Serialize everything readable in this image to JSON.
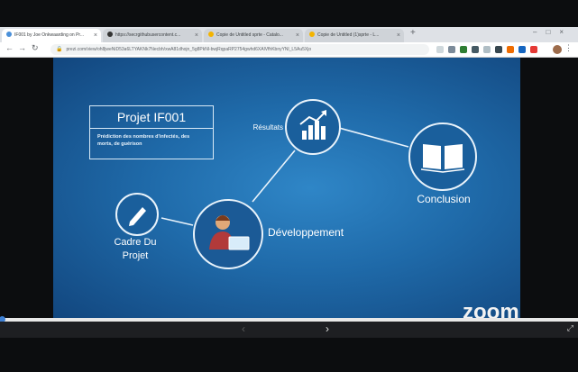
{
  "browser": {
    "tabs": [
      {
        "label": "IF001 by Joe Onkwaarding on Pr...",
        "active": true,
        "color": "#4a90d9"
      },
      {
        "label": "https://secrgithubusercontent.c...",
        "active": false,
        "color": "#333333"
      },
      {
        "label": "Copie de Untitled sprte - Catalo...",
        "active": false,
        "color": "#f4b400"
      },
      {
        "label": "Copie de Untitled (1)sprte - L...",
        "active": false,
        "color": "#f4b400"
      }
    ],
    "new_tab": "+",
    "url": "prezi.com/view/oh8jweNiD53a6LTYAKNk7Necbh/xwA81dhojn_5g8PkNl-bwjRqpaRP2754gwhd6XAlVfhKbnyYNl_L5Au5Xjo",
    "back": "←",
    "forward": "→",
    "reload": "↻"
  },
  "prezi": {
    "title": "Projet IF001",
    "subtitle": "Prédiction des nombres d'infectés, des morts, de guérison",
    "resultats": "Résultats",
    "conclusion": "Conclusion",
    "developpement": "Développement",
    "cadre_line1": "Cadre Du",
    "cadre_line2": "Projet",
    "colors": {
      "background": "#1f6aa9",
      "stroke": "#e9f3fb",
      "node_fill": "#1a5f9c"
    }
  },
  "zoom": {
    "logo": "zoom",
    "progress": 0.0,
    "prev_icon": "‹",
    "next_icon": "›",
    "fullscreen_icon": "⤢"
  }
}
